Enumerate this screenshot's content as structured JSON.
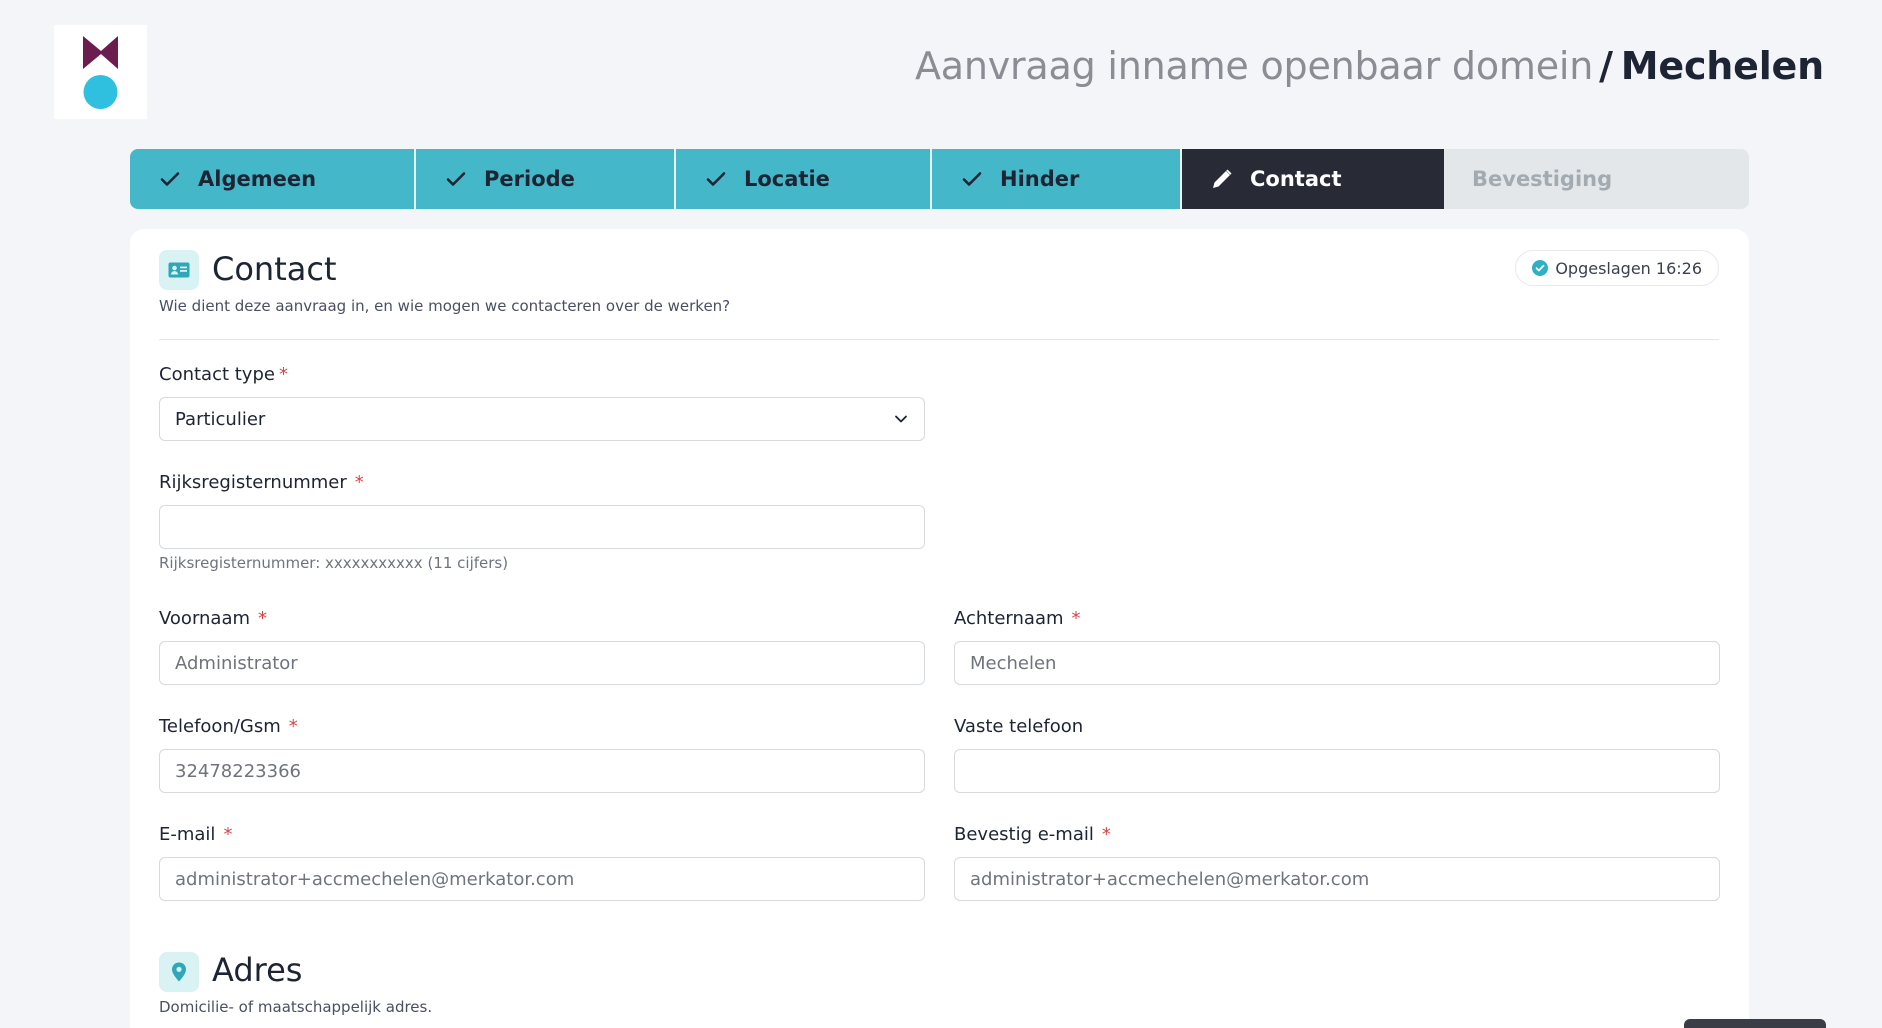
{
  "header": {
    "title_prefix": "Aanvraag inname openbaar domein",
    "separator": "/",
    "city": "Mechelen"
  },
  "steps": [
    {
      "label": "Algemeen",
      "state": "done"
    },
    {
      "label": "Periode",
      "state": "done"
    },
    {
      "label": "Locatie",
      "state": "done"
    },
    {
      "label": "Hinder",
      "state": "done"
    },
    {
      "label": "Contact",
      "state": "active"
    },
    {
      "label": "Bevestiging",
      "state": "todo"
    }
  ],
  "contact_section": {
    "title": "Contact",
    "subtitle": "Wie dient deze aanvraag in, en wie mogen we contacteren over de werken?",
    "saved_badge": "Opgeslagen 16:26"
  },
  "form": {
    "required_mark": "*",
    "contact_type": {
      "label": "Contact type",
      "value": "Particulier"
    },
    "rijksregisternummer": {
      "label": "Rijksregisternummer",
      "value": "",
      "hint": "Rijksregisternummer: xxxxxxxxxxx (11 cijfers)"
    },
    "voornaam": {
      "label": "Voornaam",
      "value": "Administrator"
    },
    "achternaam": {
      "label": "Achternaam",
      "value": "Mechelen"
    },
    "telefoon_gsm": {
      "label": "Telefoon/Gsm",
      "value": "32478223366"
    },
    "vaste_telefoon": {
      "label": "Vaste telefoon",
      "value": ""
    },
    "email": {
      "label": "E-mail",
      "value": "administrator+accmechelen@merkator.com"
    },
    "bevestig_email": {
      "label": "Bevestig e-mail",
      "value": "administrator+accmechelen@merkator.com"
    }
  },
  "address_section": {
    "title": "Adres",
    "subtitle": "Domicilie- of maatschappelijk adres."
  },
  "colors": {
    "accent": "#44b8c8",
    "active_step": "#282b36",
    "logo_purple": "#6b1d4f",
    "logo_cyan": "#2fc0e0",
    "required": "#d64545"
  },
  "icons": {
    "step_done": "check-icon",
    "step_active": "pencil-icon",
    "contact": "id-card-icon",
    "address": "map-pin-icon",
    "select": "chevron-down-icon",
    "saved": "check-circle-icon"
  }
}
